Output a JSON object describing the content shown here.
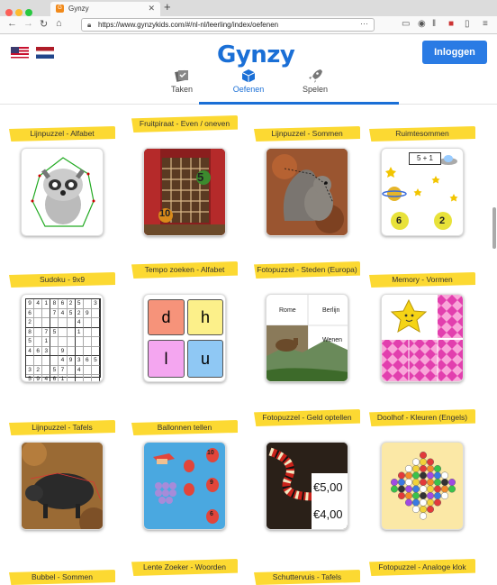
{
  "browser": {
    "tab_title": "Gynzy",
    "url": "https://www.gynzykids.com/#/nl-nl/leerling/index/oefenen",
    "new_tab_label": "+"
  },
  "header": {
    "logo": "Gynzy",
    "login_label": "Inloggen",
    "nav": [
      {
        "label": "Taken",
        "icon": "tasks-icon"
      },
      {
        "label": "Oefenen",
        "icon": "cube-icon"
      },
      {
        "label": "Spelen",
        "icon": "rocket-icon"
      }
    ],
    "languages": [
      "us-flag",
      "nl-flag"
    ]
  },
  "colors": {
    "accent": "#1a6fd6",
    "banner": "#fcd932",
    "login": "#2a7be4"
  },
  "games": [
    {
      "title": "Lijnpuzzel - Alfabet"
    },
    {
      "title": "Fruitpiraat - Even / oneven"
    },
    {
      "title": "Lijnpuzzel - Sommen"
    },
    {
      "title": "Ruimtesommen"
    },
    {
      "title": "Sudoku - 9x9"
    },
    {
      "title": "Tempo zoeken - Alfabet"
    },
    {
      "title": "Fotopuzzel - Steden (Europa)"
    },
    {
      "title": "Memory - Vormen"
    },
    {
      "title": "Lijnpuzzel - Tafels"
    },
    {
      "title": "Ballonnen tellen"
    },
    {
      "title": "Fotopuzzel - Geld optellen"
    },
    {
      "title": "Doolhof - Kleuren (Engels)"
    },
    {
      "title": "Bubbel - Sommen"
    },
    {
      "title": "Lente Zoeker - Woorden"
    },
    {
      "title": "Schuttervuis - Tafels"
    },
    {
      "title": "Fotopuzzel - Analoge klok"
    }
  ],
  "thumb_text": {
    "fruit_numbers": [
      "5",
      "10"
    ],
    "space_sum": "5 + 1",
    "space_answers": [
      "6",
      "2"
    ],
    "letters": [
      "d",
      "h",
      "l",
      "u"
    ],
    "cities": [
      "Rome",
      "Berlijn",
      "Wenen"
    ],
    "money": [
      "€5,00",
      "€4,00"
    ],
    "balloon_numbers": [
      "10",
      "9",
      "6"
    ],
    "sudoku": [
      [
        "9",
        "4",
        "1",
        "8",
        "6",
        "2",
        "5",
        "",
        "3"
      ],
      [
        "6",
        "",
        "",
        "7",
        "4",
        "5",
        "2",
        "9",
        ""
      ],
      [
        "2",
        "",
        "",
        "",
        "",
        "",
        "4",
        "",
        ""
      ],
      [
        "8",
        "",
        "7",
        "5",
        "",
        "",
        "1",
        "",
        ""
      ],
      [
        "5",
        "",
        "1",
        "",
        "",
        "",
        "",
        "",
        ""
      ],
      [
        "4",
        "6",
        "3",
        "",
        "9",
        "",
        "",
        "",
        ""
      ],
      [
        "",
        "",
        "",
        "",
        "4",
        "9",
        "3",
        "6",
        "5"
      ],
      [
        "3",
        "2",
        "",
        "5",
        "7",
        "",
        "4",
        "",
        ""
      ],
      [
        "5",
        "9",
        "4",
        "6",
        "1",
        "",
        "",
        "",
        ""
      ]
    ]
  }
}
